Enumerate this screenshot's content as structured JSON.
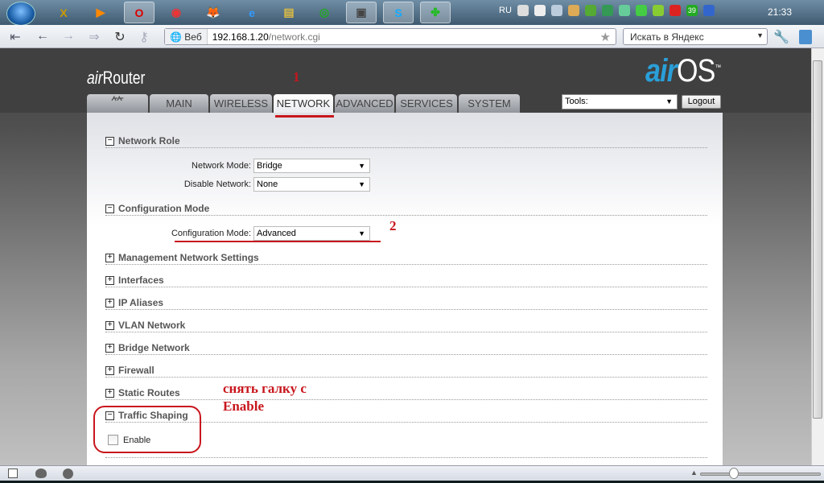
{
  "taskbar": {
    "apps": [
      "X",
      "▶",
      "O",
      "◉",
      "🦊",
      "e",
      "▤",
      "◎",
      "▣",
      "S",
      "✤"
    ],
    "tray": {
      "lang": "RU",
      "badge": "39"
    },
    "clock": "21:33"
  },
  "browser": {
    "address_label": "Веб",
    "url_host": "192.168.1.20",
    "url_path": "/network.cgi",
    "search_placeholder": "Искать в Яндекс"
  },
  "router": {
    "brand_left_prefix": "air",
    "brand_left": "Router",
    "brand_right_prefix": "air",
    "brand_right": "OS",
    "tm": "™",
    "tabs": [
      "MAIN",
      "WIRELESS",
      "NETWORK",
      "ADVANCED",
      "SERVICES",
      "SYSTEM"
    ],
    "active_tab": "NETWORK",
    "tools_label": "Tools:",
    "logout_label": "Logout"
  },
  "sections": {
    "network_role": {
      "title": "Network Role",
      "network_mode_label": "Network Mode:",
      "network_mode": "Bridge",
      "disable_network_label": "Disable Network:",
      "disable_network": "None"
    },
    "configuration_mode": {
      "title": "Configuration Mode",
      "label": "Configuration Mode:",
      "value": "Advanced"
    },
    "collapsed": [
      "Management Network Settings",
      "Interfaces",
      "IP Aliases",
      "VLAN Network",
      "Bridge Network",
      "Firewall",
      "Static Routes"
    ],
    "traffic_shaping": {
      "title": "Traffic Shaping",
      "enable_label": "Enable",
      "enabled": false
    }
  },
  "annotations": {
    "step1": "1",
    "step2": "2",
    "note_line1": "снять галку с",
    "note_line2": "Enable",
    "color": "#c8161d"
  }
}
